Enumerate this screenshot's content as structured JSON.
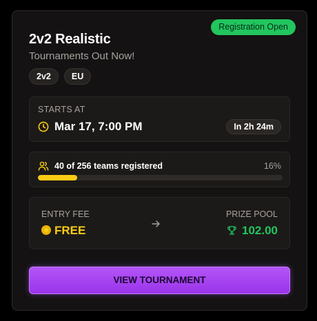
{
  "card": {
    "badge": "Registration Open",
    "title": "2v2 Realistic",
    "subtitle": "Tournaments Out Now!",
    "tags": [
      "2v2",
      "EU"
    ]
  },
  "start": {
    "label": "STARTS AT",
    "date": "Mar 17, 7:00 PM",
    "countdown": "In 2h 24m",
    "icon": "clock-icon"
  },
  "registration": {
    "text": "40 of 256 teams registered",
    "percent_label": "16%",
    "progress_fraction": 0.16,
    "icon": "users-icon"
  },
  "fee": {
    "label": "ENTRY FEE",
    "value": "FREE",
    "icon": "coin-icon"
  },
  "prize": {
    "label": "PRIZE POOL",
    "value": "102.00",
    "icon": "trophy-icon"
  },
  "cta": {
    "label": "VIEW TOURNAMENT"
  },
  "colors": {
    "accent_purple": "#a855f7",
    "status_green": "#22c55e",
    "highlight_yellow": "#facc15"
  }
}
